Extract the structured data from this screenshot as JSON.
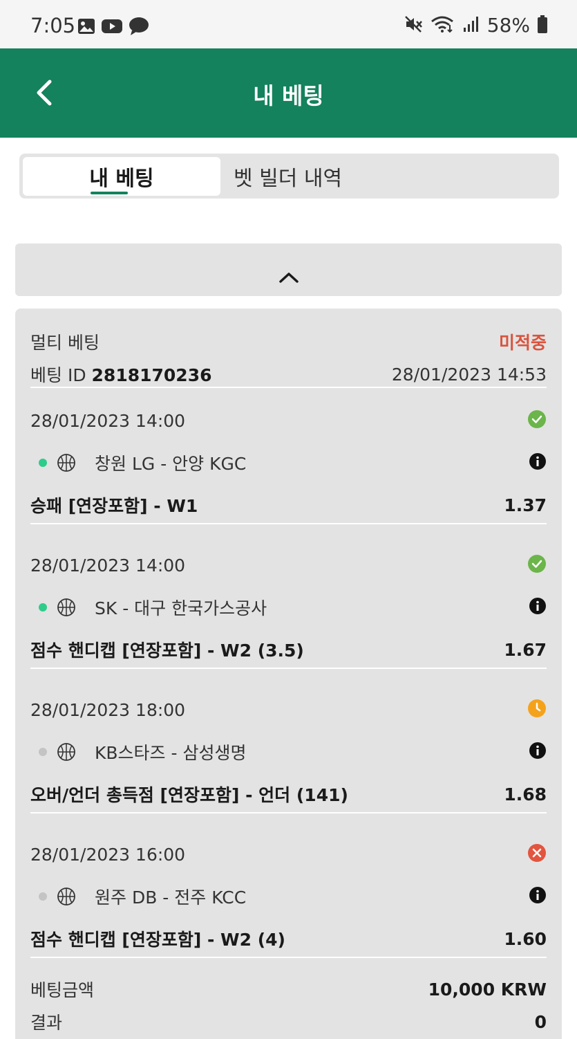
{
  "status_bar": {
    "time": "7:05",
    "battery": "58%",
    "icons": [
      "image-icon",
      "youtube-icon",
      "chat-icon",
      "mute-icon",
      "wifi-icon",
      "signal-icon",
      "battery-icon"
    ]
  },
  "header": {
    "title": "내 베팅"
  },
  "tabs": [
    {
      "label": "내 베팅",
      "active": true
    },
    {
      "label": "벳 빌더 내역",
      "active": false
    }
  ],
  "bet": {
    "type": "멀티 베팅",
    "status": "미적중",
    "id_label": "베팅 ID",
    "id": "2818170236",
    "placed_at": "28/01/2023 14:53",
    "selections": [
      {
        "datetime": "28/01/2023 14:00",
        "result": "won",
        "live": true,
        "match": "창원 LG - 안양 KGC",
        "market": "승패 [연장포함] - W1",
        "odds": "1.37"
      },
      {
        "datetime": "28/01/2023 14:00",
        "result": "won",
        "live": true,
        "match": "SK - 대구 한국가스공사",
        "market": "점수 핸디캡 [연장포함] - W2 (3.5)",
        "odds": "1.67"
      },
      {
        "datetime": "28/01/2023 18:00",
        "result": "pending",
        "live": false,
        "match": "KB스타즈 - 삼성생명",
        "market": "오버/언더 총득점 [연장포함] - 언더 (141)",
        "odds": "1.68"
      },
      {
        "datetime": "28/01/2023 16:00",
        "result": "lost",
        "live": false,
        "match": "원주 DB - 전주 KCC",
        "market": "점수 핸디캡 [연장포함] - W2 (4)",
        "odds": "1.60"
      }
    ],
    "stake_label": "베팅금액",
    "stake": "10,000 KRW",
    "payout_label": "결과",
    "payout": "0"
  },
  "colors": {
    "header_bg": "#13825d",
    "won": "#6bb54a",
    "pending": "#f5a21b",
    "lost": "#e2553f",
    "live_dot": "#2ecc8a",
    "idle_dot": "#c4c4c4",
    "status_lost_text": "#d9533d"
  }
}
